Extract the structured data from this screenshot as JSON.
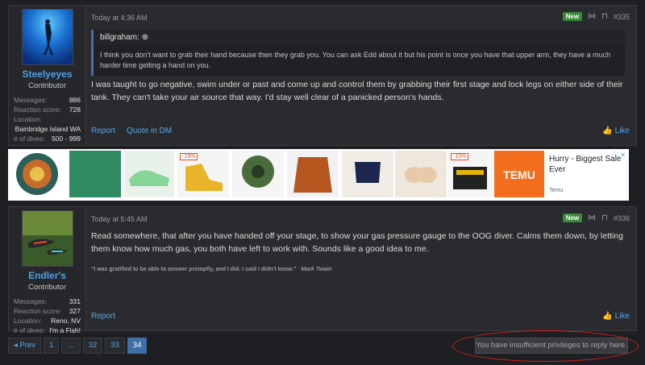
{
  "posts": [
    {
      "username": "Steelyeyes",
      "user_title": "Contributor",
      "stats": [
        {
          "label": "Messages:",
          "value": "886"
        },
        {
          "label": "Reaction score:",
          "value": "728"
        }
      ],
      "location_label": "Location:",
      "location_value": "Bainbridge Island WA",
      "dives_label": "# of dives:",
      "dives_value": "500 - 999",
      "date": "Today at 4:36 AM",
      "badge": "New",
      "post_number": "#335",
      "quote_author": "billgraham:",
      "quote_text": "I think you don't want to grab their hand because then they grab you. You can ask Edd about it but his point is once you have that upper arm, they have a much harder time getting a hand on you.",
      "body": "I was taught to go negative, swim under or past and come up and control them by grabbing their first stage and lock legs on either side of their tank. They can't take your air source that way. I'd stay well clear of a panicked person's hands.",
      "actions": [
        "Report",
        "Quote in DM"
      ],
      "like_label": "Like"
    },
    {
      "username": "Endler's",
      "user_title": "Contributor",
      "stats": [
        {
          "label": "Messages:",
          "value": "331"
        },
        {
          "label": "Reaction score:",
          "value": "327"
        },
        {
          "label": "Location:",
          "value": "Reno, NV"
        },
        {
          "label": "# of dives:",
          "value": "I'm a Fish!"
        }
      ],
      "date": "Today at 5:45 AM",
      "badge": "New",
      "post_number": "#336",
      "body": "Read somewhere, that after you have handed off your stage, to show your gas pressure gauge to the OOG diver. Calms them down, by letting them know how much gas, you both have left to work with. Sounds like a good idea to me.",
      "signature": "\"I was gratified to be able to answer promptly, and I did. I said I didn't know.\"",
      "signature_author": "Mark Twain",
      "actions": [
        "Report"
      ],
      "like_label": "Like"
    }
  ],
  "ad": {
    "tags": [
      "-19%",
      "-10%"
    ],
    "logo_text": "TEMU",
    "headline": "Hurry - Biggest Sale Ever",
    "brand": "Temu"
  },
  "pagination": {
    "prev": "◂ Prev",
    "pages": [
      "1",
      "…",
      "32",
      "33",
      "34"
    ],
    "current": "34"
  },
  "reply_notice": "You have insufficient privileges to reply here.",
  "colors": {
    "accent": "#4ea1e6",
    "new_badge": "#3a8a3a",
    "annotation_circle": "#d6201f"
  }
}
